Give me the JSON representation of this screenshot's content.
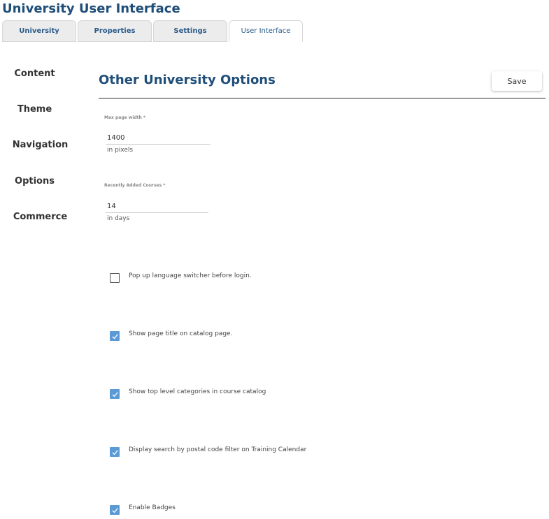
{
  "header": {
    "title": "University User Interface"
  },
  "tabs": [
    {
      "label": "University"
    },
    {
      "label": "Properties"
    },
    {
      "label": "Settings"
    },
    {
      "label": "User Interface",
      "active": true
    }
  ],
  "sidebar": {
    "items": [
      {
        "label": "Content"
      },
      {
        "label": "Theme"
      },
      {
        "label": "Navigation"
      },
      {
        "label": "Options"
      },
      {
        "label": "Commerce"
      }
    ]
  },
  "main": {
    "title": "Other University Options",
    "save_label": "Save",
    "fields": [
      {
        "label": "Max page width *",
        "value": "1400",
        "hint": "in pixels"
      },
      {
        "label": "Recently Added Courses *",
        "value": "14",
        "hint": "in days"
      }
    ],
    "checkboxes": [
      {
        "label": "Pop up language switcher before login.",
        "checked": false
      },
      {
        "label": "Show page title on catalog page.",
        "checked": true
      },
      {
        "label": "Show top level categories in course catalog",
        "checked": true
      },
      {
        "label": "Display search by postal code filter on Training Calendar",
        "checked": true
      },
      {
        "label": "Enable Badges",
        "checked": true
      }
    ]
  },
  "colors": {
    "accent": "#1f4e79",
    "checkbox_checked": "#5b9bd5",
    "tab_bg": "#ececec"
  }
}
